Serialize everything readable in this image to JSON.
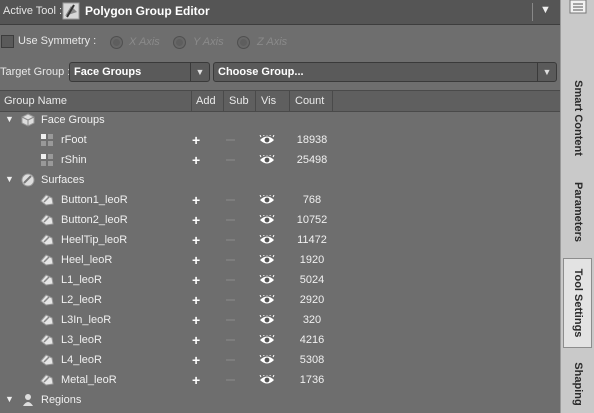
{
  "toolbar": {
    "label": "Active Tool :",
    "tool_name": "Polygon Group Editor",
    "menu_glyph": "▼"
  },
  "symmetry": {
    "label": "Use Symmetry :",
    "checked": false,
    "axes": [
      "X Axis",
      "Y Axis",
      "Z Axis"
    ]
  },
  "target": {
    "label": "Target Group :",
    "group_value": "Face Groups",
    "choose_value": "Choose Group..."
  },
  "table": {
    "columns": [
      "Group Name",
      "Add",
      "Sub",
      "Vis",
      "Count"
    ],
    "sections": [
      {
        "label": "Face Groups",
        "icon": "face-groups-icon",
        "items": [
          {
            "name": "rFoot",
            "count": "18938",
            "icon": "face-group-item-icon"
          },
          {
            "name": "rShin",
            "count": "25498",
            "icon": "face-group-item-icon"
          }
        ]
      },
      {
        "label": "Surfaces",
        "icon": "surfaces-icon",
        "items": [
          {
            "name": "Button1_leoR",
            "count": "768",
            "icon": "surface-item-icon"
          },
          {
            "name": "Button2_leoR",
            "count": "10752",
            "icon": "surface-item-icon"
          },
          {
            "name": "HeelTip_leoR",
            "count": "11472",
            "icon": "surface-item-icon"
          },
          {
            "name": "Heel_leoR",
            "count": "1920",
            "icon": "surface-item-icon"
          },
          {
            "name": "L1_leoR",
            "count": "5024",
            "icon": "surface-item-icon"
          },
          {
            "name": "L2_leoR",
            "count": "2920",
            "icon": "surface-item-icon"
          },
          {
            "name": "L3In_leoR",
            "count": "320",
            "icon": "surface-item-icon"
          },
          {
            "name": "L3_leoR",
            "count": "4216",
            "icon": "surface-item-icon"
          },
          {
            "name": "L4_leoR",
            "count": "5308",
            "icon": "surface-item-icon"
          },
          {
            "name": "Metal_leoR",
            "count": "1736",
            "icon": "surface-item-icon"
          }
        ]
      },
      {
        "label": "Regions",
        "icon": "regions-icon",
        "items": []
      }
    ]
  },
  "side_tabs": [
    {
      "label": "Smart Content",
      "active": false
    },
    {
      "label": "Parameters",
      "active": false
    },
    {
      "label": "Tool Settings",
      "active": true
    },
    {
      "label": "Shaping",
      "active": false
    }
  ],
  "colors": {
    "panel_bg": "#6e6e6e",
    "toolbar_bg": "#555555",
    "side_bg": "#c9c9c9"
  }
}
